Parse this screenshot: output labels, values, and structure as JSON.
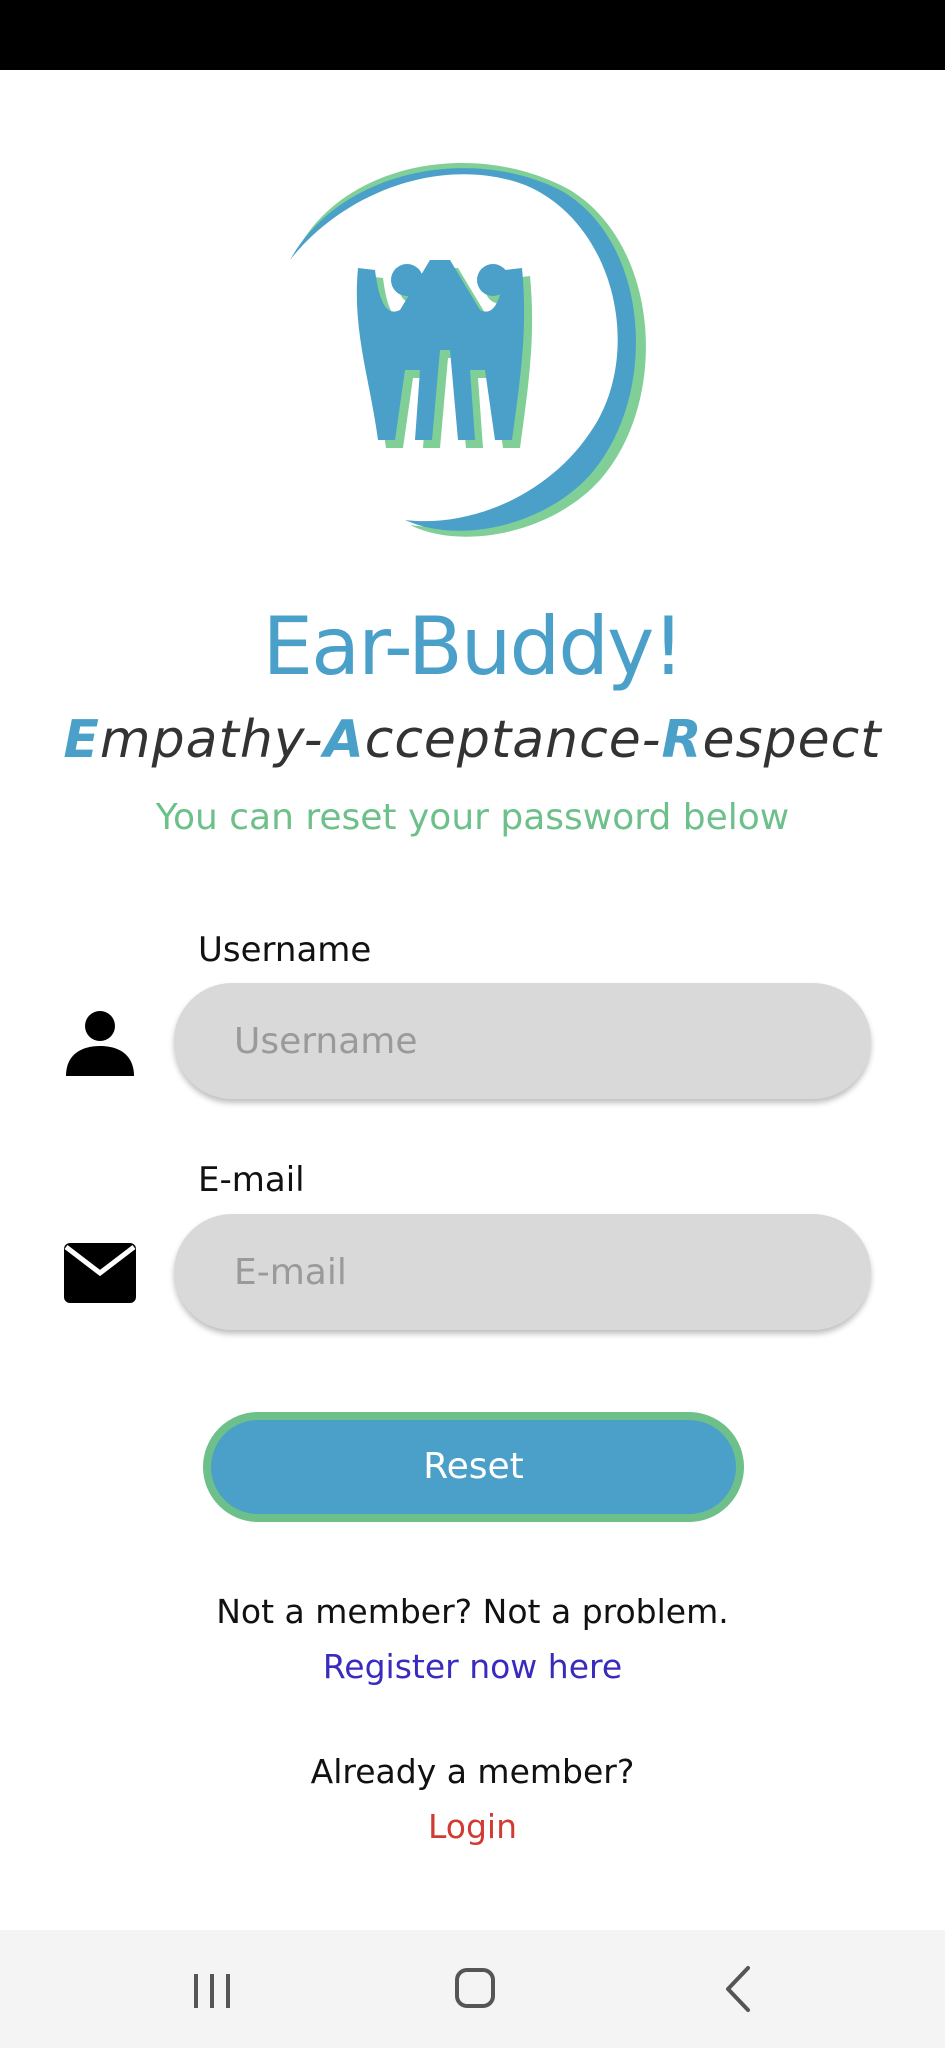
{
  "app": {
    "title": "Ear-Buddy!",
    "tagline": {
      "e": "E",
      "mpathy": "mpathy-",
      "a": "A",
      "cceptance": "cceptance-",
      "r": "R",
      "espect": "espect"
    },
    "subtitle": "You can reset your password below"
  },
  "form": {
    "username": {
      "label": "Username",
      "placeholder": "Username",
      "value": ""
    },
    "email": {
      "label": "E-mail",
      "placeholder": "E-mail",
      "value": ""
    },
    "reset_label": "Reset"
  },
  "footer": {
    "not_member_text": "Not a member? Not a problem.",
    "register_link": "Register now here",
    "already_member_text": "Already a member?",
    "login_link": "Login"
  },
  "colors": {
    "brand_blue": "#4aa0c9",
    "brand_green": "#6dc08a",
    "register_link": "#3a2bbf",
    "login_link": "#d23b32"
  },
  "icons": {
    "logo": "ear-buddy-logo",
    "username": "person-icon",
    "email": "envelope-icon",
    "nav_recents": "recent-apps-icon",
    "nav_home": "home-icon",
    "nav_back": "back-icon"
  }
}
